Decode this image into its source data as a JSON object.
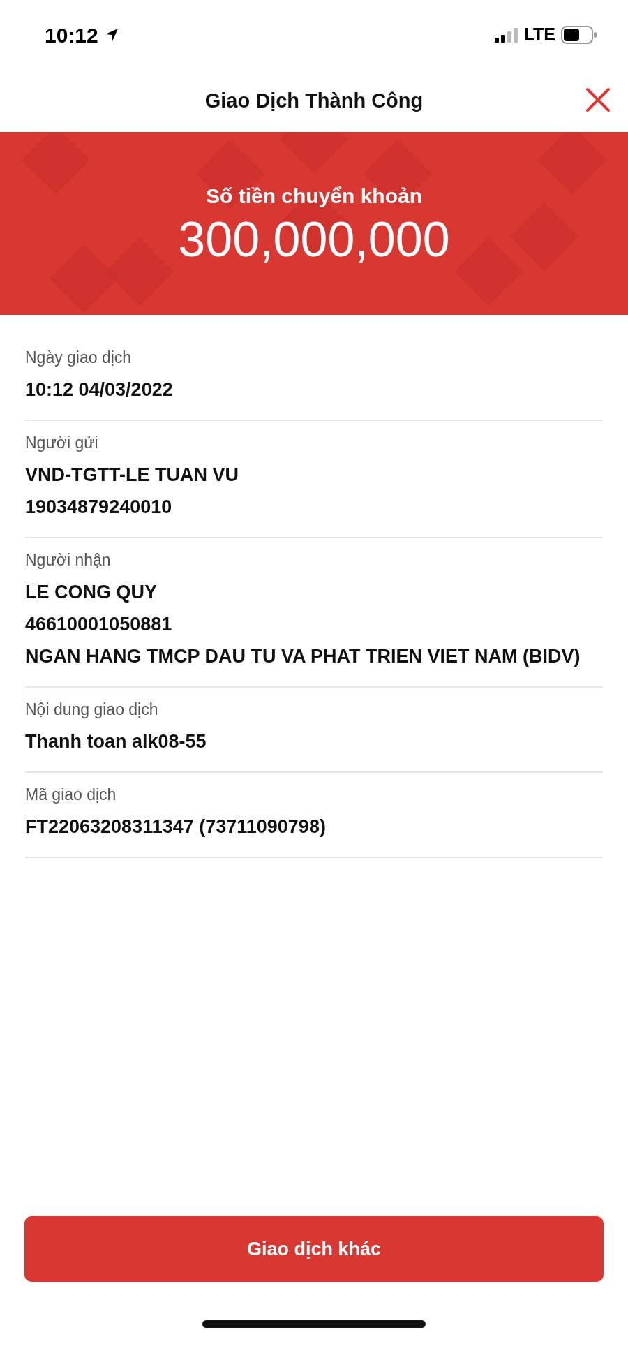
{
  "status_bar": {
    "time": "10:12",
    "network": "LTE"
  },
  "header": {
    "title": "Giao Dịch Thành Công"
  },
  "amount": {
    "label": "Số tiền chuyển khoản",
    "value": "300,000,000"
  },
  "details": [
    {
      "label": "Ngày giao dịch",
      "lines": [
        "10:12 04/03/2022"
      ]
    },
    {
      "label": "Người gửi",
      "lines": [
        "VND-TGTT-LE TUAN VU",
        "19034879240010"
      ]
    },
    {
      "label": "Người nhận",
      "lines": [
        "LE CONG QUY",
        "46610001050881",
        "NGAN HANG TMCP DAU TU VA PHAT TRIEN VIET NAM (BIDV)"
      ]
    },
    {
      "label": "Nội dung giao dịch",
      "lines": [
        "Thanh toan alk08-55"
      ]
    },
    {
      "label": "Mã giao dịch",
      "lines": [
        "FT22063208311347 (73711090798)"
      ]
    }
  ],
  "button": "Giao dịch khác"
}
